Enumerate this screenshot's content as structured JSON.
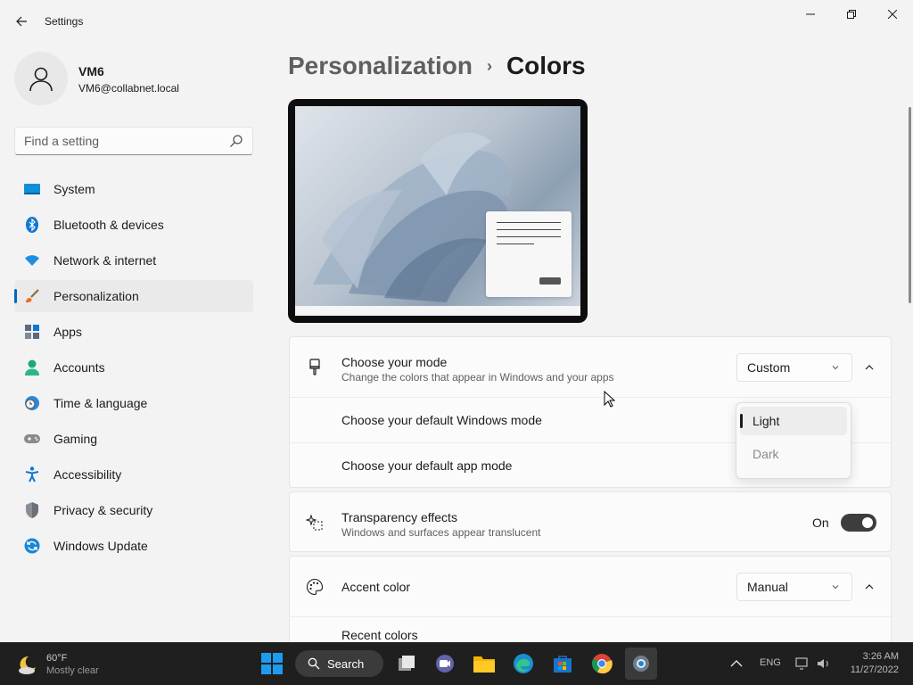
{
  "window": {
    "title": "Settings",
    "back_icon": "back-arrow-icon",
    "controls": [
      "minimize-icon",
      "restore-icon",
      "close-icon"
    ]
  },
  "profile": {
    "name": "VM6",
    "email": "VM6@collabnet.local"
  },
  "search": {
    "placeholder": "Find a setting"
  },
  "sidebar": {
    "items": [
      {
        "label": "System",
        "icon": "system-icon"
      },
      {
        "label": "Bluetooth & devices",
        "icon": "bluetooth-icon"
      },
      {
        "label": "Network & internet",
        "icon": "wifi-icon"
      },
      {
        "label": "Personalization",
        "icon": "brush-icon",
        "active": true
      },
      {
        "label": "Apps",
        "icon": "apps-icon"
      },
      {
        "label": "Accounts",
        "icon": "accounts-icon"
      },
      {
        "label": "Time & language",
        "icon": "clock-globe-icon"
      },
      {
        "label": "Gaming",
        "icon": "gamepad-icon"
      },
      {
        "label": "Accessibility",
        "icon": "accessibility-icon"
      },
      {
        "label": "Privacy & security",
        "icon": "shield-icon"
      },
      {
        "label": "Windows Update",
        "icon": "update-icon"
      }
    ]
  },
  "breadcrumb": {
    "parent": "Personalization",
    "separator": "›",
    "current": "Colors"
  },
  "mode": {
    "title": "Choose your mode",
    "subtitle": "Change the colors that appear in Windows and your apps",
    "value": "Custom",
    "windows_mode_label": "Choose your default Windows mode",
    "app_mode_label": "Choose your default app mode",
    "options": [
      "Light",
      "Dark"
    ],
    "selected_option": "Light"
  },
  "transparency": {
    "title": "Transparency effects",
    "subtitle": "Windows and surfaces appear translucent",
    "state_label": "On"
  },
  "accent": {
    "title": "Accent color",
    "value": "Manual",
    "recent_colors_label": "Recent colors"
  },
  "taskbar": {
    "weather_temp": "60°F",
    "weather_cond": "Mostly clear",
    "search_label": "Search",
    "lang": "ENG",
    "time": "3:26 AM",
    "date": "11/27/2022"
  },
  "colors": {
    "accent": "#0067c0",
    "toggle_on": "#3d3d3d",
    "taskbar_bg": "#1f1f1f"
  }
}
